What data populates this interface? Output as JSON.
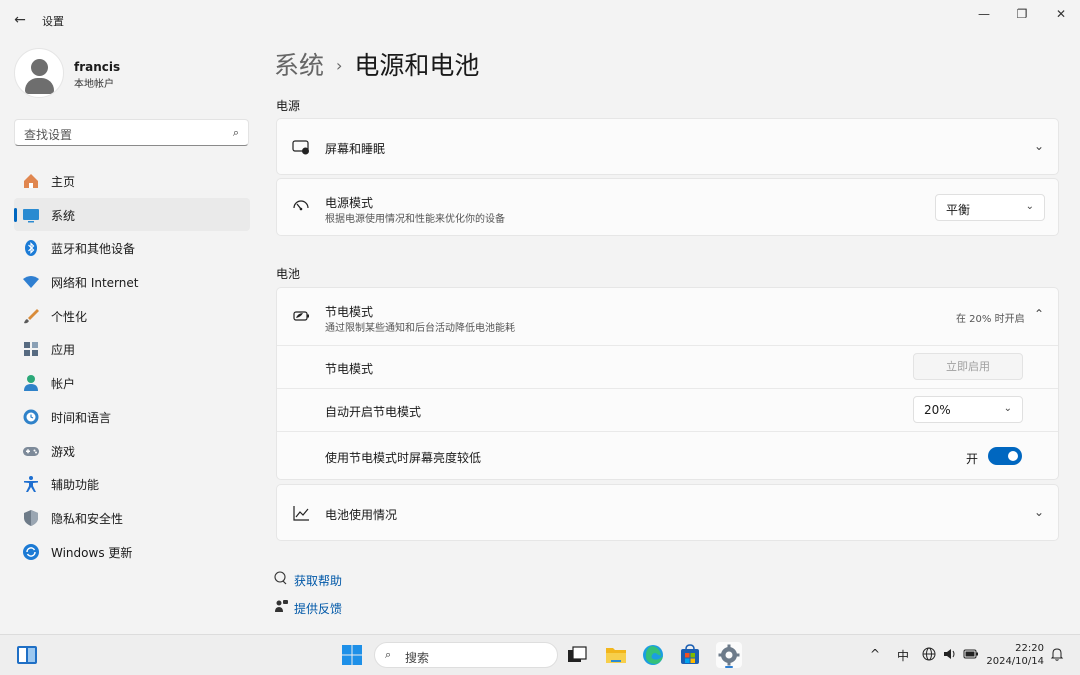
{
  "window": {
    "title": "设置",
    "back_glyph": "←",
    "minimize_glyph": "—",
    "restore_glyph": "❐",
    "close_glyph": "✕"
  },
  "profile": {
    "name": "francis",
    "account_type": "本地帐户"
  },
  "search": {
    "placeholder": "查找设置",
    "icon": "search-icon"
  },
  "sidebar": {
    "items": [
      {
        "label": "主页",
        "icon": "home-icon",
        "color": "#e0864f",
        "active": false
      },
      {
        "label": "系统",
        "icon": "system-icon",
        "color": "#2a8bd1",
        "active": true
      },
      {
        "label": "蓝牙和其他设备",
        "icon": "bluetooth-icon",
        "color": "#1b7bd6",
        "active": false
      },
      {
        "label": "网络和 Internet",
        "icon": "network-icon",
        "color": "#2f7fd1",
        "active": false
      },
      {
        "label": "个性化",
        "icon": "brush-icon",
        "color": "#d98c3a",
        "active": false
      },
      {
        "label": "应用",
        "icon": "apps-icon",
        "color": "#566a80",
        "active": false
      },
      {
        "label": "帐户",
        "icon": "account-icon",
        "color": "#2ba878",
        "active": false
      },
      {
        "label": "时间和语言",
        "icon": "clock-globe-icon",
        "color": "#2f82c9",
        "active": false
      },
      {
        "label": "游戏",
        "icon": "gamepad-icon",
        "color": "#7d8a99",
        "active": false
      },
      {
        "label": "辅助功能",
        "icon": "accessibility-icon",
        "color": "#1e6fd0",
        "active": false
      },
      {
        "label": "隐私和安全性",
        "icon": "shield-icon",
        "color": "#6e7b88",
        "active": false
      },
      {
        "label": "Windows 更新",
        "icon": "update-icon",
        "color": "#1c7ad4",
        "active": false
      }
    ]
  },
  "breadcrumb": {
    "parent": "系统",
    "separator": "›",
    "current": "电源和电池"
  },
  "power": {
    "section_title": "电源",
    "screen_sleep": {
      "label": "屏幕和睡眠",
      "icon": "screen-sleep-icon"
    },
    "power_mode": {
      "label": "电源模式",
      "description": "根据电源使用情况和性能来优化你的设备",
      "icon": "power-mode-icon",
      "value": "平衡"
    }
  },
  "battery": {
    "section_title": "电池",
    "saver": {
      "label": "节电模式",
      "description": "通过限制某些通知和后台活动降低电池能耗",
      "status": "在 20% 时开启",
      "icon": "battery-saver-icon",
      "rows": {
        "saver_now": {
          "label": "节电模式",
          "button": "立即启用"
        },
        "auto_on": {
          "label": "自动开启节电模式",
          "value": "20%"
        },
        "lower_brightness": {
          "label": "使用节电模式时屏幕亮度较低",
          "state": "开",
          "on": true
        }
      }
    },
    "usage": {
      "label": "电池使用情况",
      "icon": "chart-icon"
    }
  },
  "links": {
    "help": {
      "label": "获取帮助",
      "icon": "help-icon"
    },
    "feedback": {
      "label": "提供反馈",
      "icon": "feedback-icon"
    }
  },
  "taskbar": {
    "search_placeholder": "搜索",
    "ime": "中",
    "time": "22:20",
    "date": "2024/10/14",
    "up_arrow": "^"
  },
  "colors": {
    "accent": "#0067c0",
    "link": "#0058a8"
  }
}
